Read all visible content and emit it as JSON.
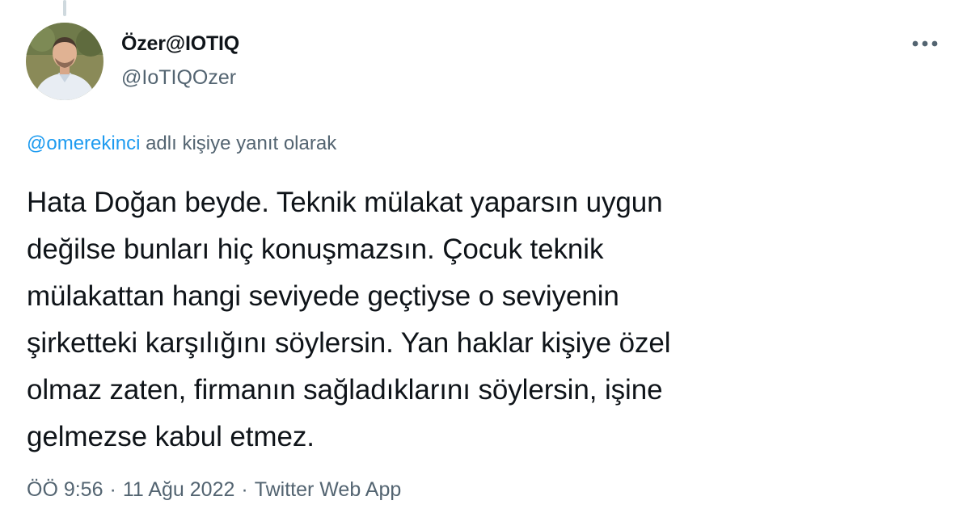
{
  "author": {
    "display_name": "Özer@IOTIQ",
    "handle": "@IoTIQOzer"
  },
  "reply_context": {
    "mention": "@omerekinci",
    "suffix": "adlı kişiye yanıt olarak"
  },
  "tweet": {
    "lines": [
      "Hata Doğan beyde. Teknik mülakat yaparsın uygun",
      "değilse bunları hiç konuşmazsın. Çocuk teknik",
      "mülakattan hangi seviyede geçtiyse o seviyenin",
      "şirketteki karşılığını söylersin. Yan haklar kişiye özel",
      "olmaz zaten, firmanın sağladıklarını söylersin, işine",
      "gelmezse kabul etmez."
    ]
  },
  "meta": {
    "time": "ÖÖ 9:56",
    "separator": "·",
    "date": "11 Ağu 2022",
    "source": "Twitter Web App"
  },
  "colors": {
    "accent": "#1d9bf0",
    "text": "#0f1419",
    "secondary": "#536471"
  },
  "icons": {
    "more": "more-horizontal-icon"
  }
}
